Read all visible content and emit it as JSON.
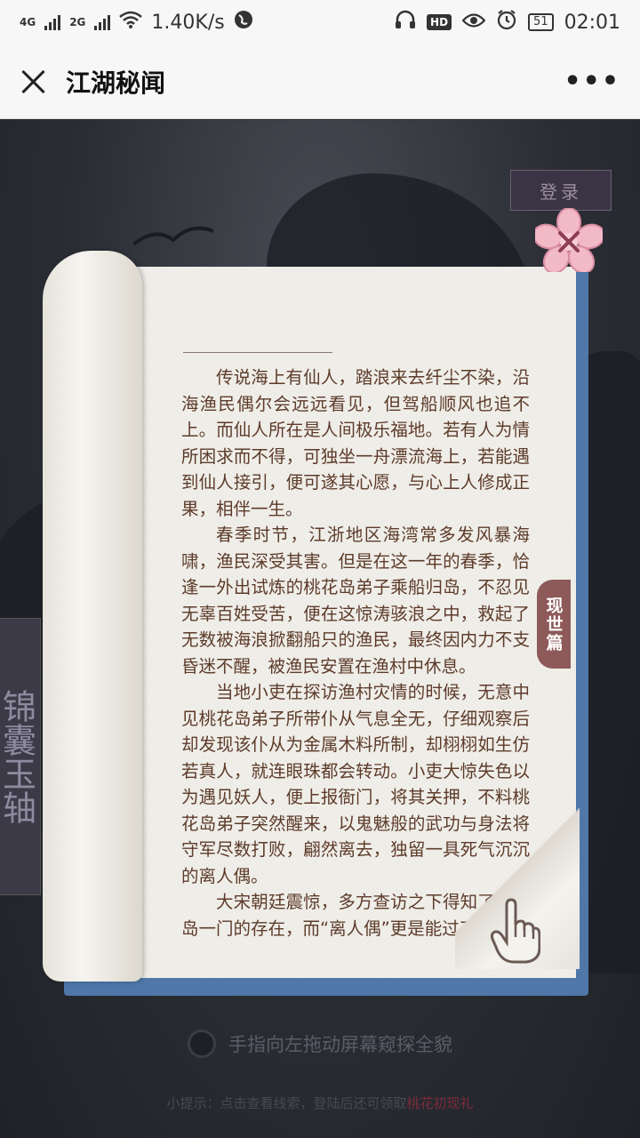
{
  "status_bar": {
    "signal_1": "4G",
    "signal_2": "2G",
    "speed": "1.40K/s",
    "hd_badge": "HD",
    "battery": "51",
    "time": "02:01"
  },
  "title_bar": {
    "title": "江湖秘闻",
    "more": "•••"
  },
  "scene": {
    "login_label": "登录",
    "sidebar_label": "锦囊玉轴"
  },
  "book": {
    "section_tab": "现世篇",
    "paragraphs": [
      "传说海上有仙人，踏浪来去纤尘不染，沿海渔民偶尔会远远看见，但驾船顺风也追不上。而仙人所在是人间极乐福地。若有人为情所困求而不得，可独坐一舟漂流海上，若能遇到仙人接引，便可遂其心愿，与心上人修成正果，相伴一生。",
      "春季时节，江浙地区海湾常多发风暴海啸，渔民深受其害。但是在这一年的春季，恰逢一外出试炼的桃花岛弟子乘船归岛，不忍见无辜百姓受苦，便在这惊涛骇浪之中，救起了无数被海浪掀翻船只的渔民，最终因内力不支昏迷不醒，被渔民安置在渔村中休息。",
      "当地小吏在探访渔村灾情的时候，无意中见桃花岛弟子所带仆从气息全无，仔细观察后却发现该仆从为金属木料所制，却栩栩如生仿若真人，就连眼珠都会转动。小吏大惊失色以为遇见妖人，便上报衙门，将其关押，不料桃花岛弟子突然醒来，以鬼魅般的武功与身法将守军尽数打败，翩然离去，独留一具死气沉沉的离人偶。",
      "大宋朝廷震惊，多方查访之下得知了桃花岛一门的存在，而“离人偶”更是能过刀山不"
    ]
  },
  "hints": {
    "swipe_text": "手指向左拖动屏幕窥探全貌",
    "tip_prefix": "小提示：点击查看线索，登陆后还可领取",
    "tip_link": "桃花初现礼"
  },
  "colors": {
    "text_brown": "#5d3b2a",
    "tab_color": "#8d5a59",
    "book_blue": "#4f78a8"
  }
}
